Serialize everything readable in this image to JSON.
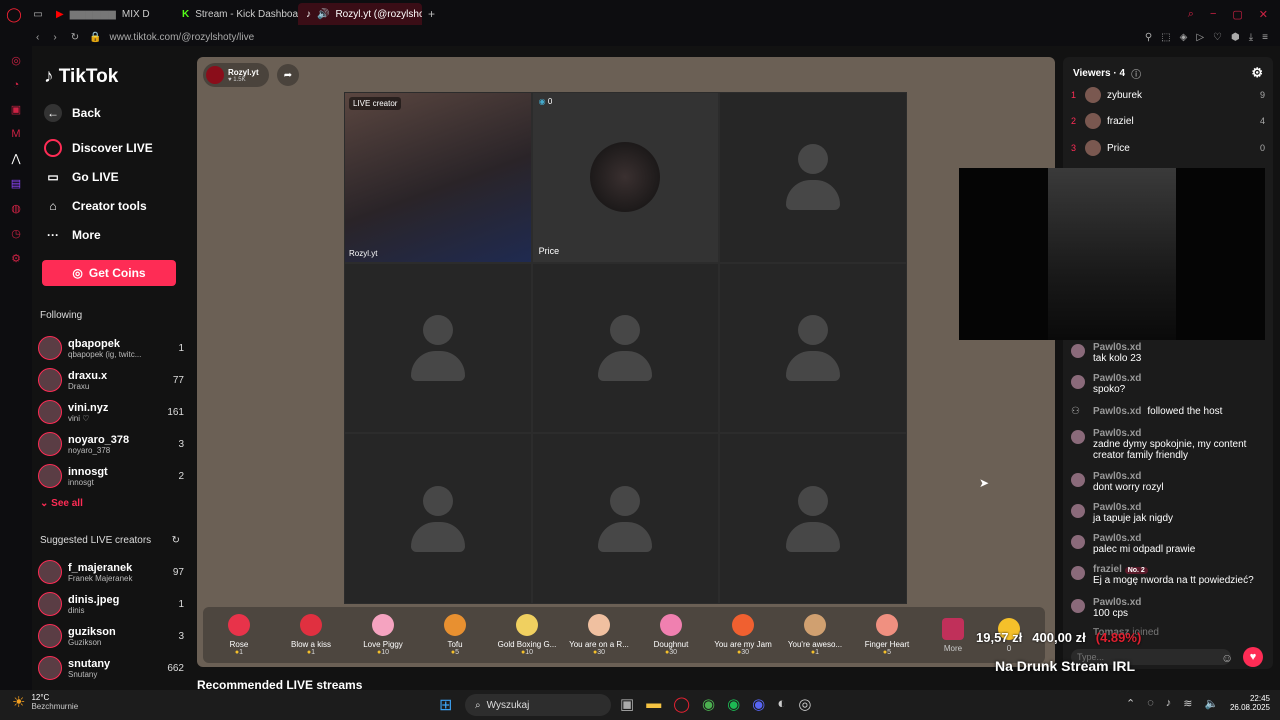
{
  "browser": {
    "tabs": [
      {
        "label": "MIX D"
      },
      {
        "label": "Stream - Kick Dashboard"
      },
      {
        "label": "Rozyl.yt (@rozylshoty"
      }
    ],
    "url": "www.tiktok.com/@rozylshoty/live"
  },
  "nav": {
    "logo": "TikTok",
    "back": "Back",
    "items": [
      "Discover LIVE",
      "Go LIVE",
      "Creator tools",
      "More"
    ],
    "coins": "Get Coins",
    "following_title": "Following",
    "following": [
      {
        "name": "qbapopek",
        "sub": "qbapopek (ig, twitc...",
        "count": "1"
      },
      {
        "name": "draxu.x",
        "sub": "Draxu",
        "count": "77"
      },
      {
        "name": "vini.nyz",
        "sub": "vini ♡",
        "count": "161"
      },
      {
        "name": "noyaro_378",
        "sub": "noyaro_378",
        "count": "3"
      },
      {
        "name": "innosgt",
        "sub": "innosgt",
        "count": "2"
      }
    ],
    "see_all": "See all",
    "suggested_title": "Suggested LIVE creators",
    "suggested": [
      {
        "name": "f_majeranek",
        "sub": "Franek Majeranek",
        "count": "97"
      },
      {
        "name": "dinis.jpeg",
        "sub": "dinis",
        "count": "1"
      },
      {
        "name": "guzikson",
        "sub": "Guzikson",
        "count": "3"
      },
      {
        "name": "snutany",
        "sub": "Snutany",
        "count": "662"
      }
    ]
  },
  "stream": {
    "host": "Rozyl.yt",
    "likes": "1.5K",
    "creator_badge": "LIVE creator",
    "creator_name": "Rozyl.yt",
    "guest_count": "0",
    "guest_name": "Price",
    "recommended": "Recommended LIVE streams"
  },
  "gifts": [
    {
      "name": "Rose",
      "price": "1",
      "color": "#e8334a"
    },
    {
      "name": "Blow a kiss",
      "price": "1",
      "color": "#e03040"
    },
    {
      "name": "Love Piggy",
      "price": "10",
      "color": "#f5a3c0"
    },
    {
      "name": "Tofu",
      "price": "5",
      "color": "#e89030"
    },
    {
      "name": "Gold Boxing G...",
      "price": "10",
      "color": "#f0d060"
    },
    {
      "name": "You are on a R...",
      "price": "30",
      "color": "#f0c0a0"
    },
    {
      "name": "Doughnut",
      "price": "30",
      "color": "#f080b0"
    },
    {
      "name": "You are my Jam",
      "price": "30",
      "color": "#f06030"
    },
    {
      "name": "You're aweso...",
      "price": "1",
      "color": "#d0a070"
    },
    {
      "name": "Finger Heart",
      "price": "5",
      "color": "#f09080"
    }
  ],
  "gift_more": "More",
  "gift_wallet": "0",
  "chat": {
    "viewers_label": "Viewers · 4",
    "viewers": [
      {
        "rank": "1",
        "name": "zyburek",
        "score": "9"
      },
      {
        "rank": "2",
        "name": "fraziel",
        "score": "4"
      },
      {
        "rank": "3",
        "name": "Price",
        "score": "0"
      }
    ],
    "messages": [
      {
        "user": "Pawl0s.xd",
        "text": "tak kolo 23"
      },
      {
        "user": "Pawl0s.xd",
        "text": "spoko?"
      },
      {
        "user": "Pawl0s.xd",
        "text": "followed the host"
      },
      {
        "user": "Pawl0s.xd",
        "text": "zadne dymy spokojnie, my content creator family friendly"
      },
      {
        "user": "Pawl0s.xd",
        "text": "dont worry rozyl"
      },
      {
        "user": "Pawl0s.xd",
        "text": "ja tapuje jak nigdy"
      },
      {
        "user": "Pawl0s.xd",
        "text": "palec mi odpadl prawie"
      },
      {
        "user": "fraziel",
        "text": "Ej a mogę nworda na tt powiedzieć?"
      },
      {
        "user": "Pawl0s.xd",
        "text": "100 cps"
      },
      {
        "user": "Tomasz",
        "text": "joined"
      }
    ],
    "badge": "No. 2",
    "input_placeholder": "Type..."
  },
  "overlay": {
    "price1": "19,57 zł",
    "price2": "400,00 zł",
    "change": "(4.89%)",
    "title": "Na Drunk Stream IRL"
  },
  "taskbar": {
    "weather": "12°C",
    "weather_desc": "Bezchmurnie",
    "search": "Wyszukaj",
    "time": "22:45",
    "date": "26.08.2025"
  },
  "colors": {
    "accent": "#fe2c55",
    "stage": "#6b6055"
  }
}
